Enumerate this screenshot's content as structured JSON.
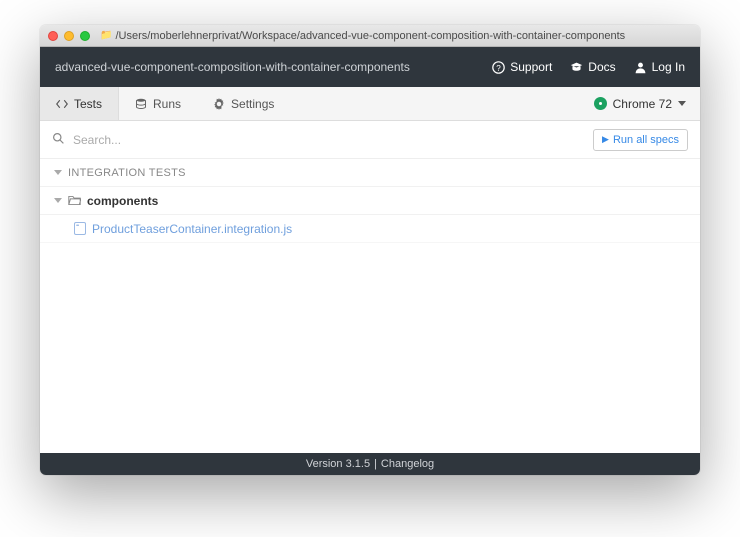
{
  "titlebar": {
    "path": "/Users/moberlehnerprivat/Workspace/advanced-vue-component-composition-with-container-components"
  },
  "header": {
    "project": "advanced-vue-component-composition-with-container-components",
    "support": "Support",
    "docs": "Docs",
    "login": "Log In"
  },
  "tabs": {
    "tests": "Tests",
    "runs": "Runs",
    "settings": "Settings",
    "browser": "Chrome 72"
  },
  "search": {
    "placeholder": "Search...",
    "run_all": "Run all specs"
  },
  "tree": {
    "section": "Integration Tests",
    "folder": "components",
    "file": "ProductTeaserContainer.integration.js"
  },
  "footer": {
    "version": "Version 3.1.5",
    "sep": "|",
    "changelog": "Changelog"
  }
}
